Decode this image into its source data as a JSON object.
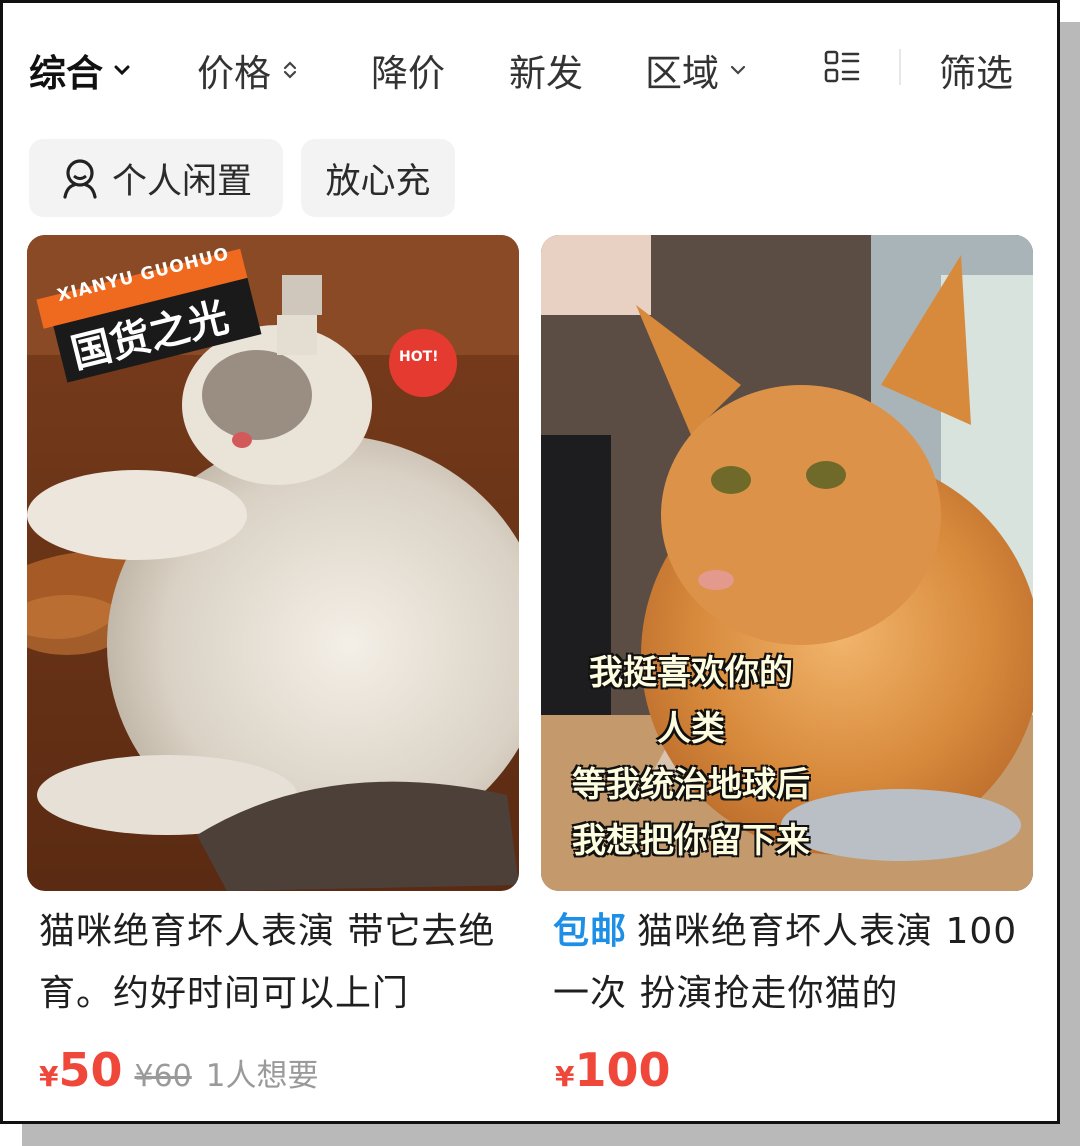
{
  "sort_bar": {
    "items": [
      {
        "label": "综合",
        "icon": "chevron-down-icon"
      },
      {
        "label": "价格",
        "icon": "sort-updown-icon"
      },
      {
        "label": "降价"
      },
      {
        "label": "新发"
      },
      {
        "label": "区域",
        "icon": "chevron-down-icon"
      }
    ],
    "layout_icon": "list-layout-icon",
    "filter_label": "筛选"
  },
  "chips": [
    {
      "label": "个人闲置",
      "icon": "person-icon"
    },
    {
      "label": "放心充"
    }
  ],
  "cards": [
    {
      "image_badge_top": "XIANYU GUOHUO",
      "image_badge_main": "国货之光",
      "image_hot": "HOT!",
      "title": "猫咪绝育坏人表演 带它去绝育。约好时间可以上门",
      "currency": "¥",
      "price": "50",
      "original_price": "¥60",
      "wants": "1人想要"
    },
    {
      "tag": "包邮",
      "image_caption": [
        "我挺喜欢你的",
        "人类",
        "等我统治地球后",
        "我想把你留下来"
      ],
      "title": "猫咪绝育坏人表演 100一次 扮演抢走你猫的",
      "currency": "¥",
      "price": "100"
    }
  ],
  "colors": {
    "price": "#f0473b",
    "tag": "#1e8fe6",
    "chip_bg": "#f3f3f3"
  }
}
